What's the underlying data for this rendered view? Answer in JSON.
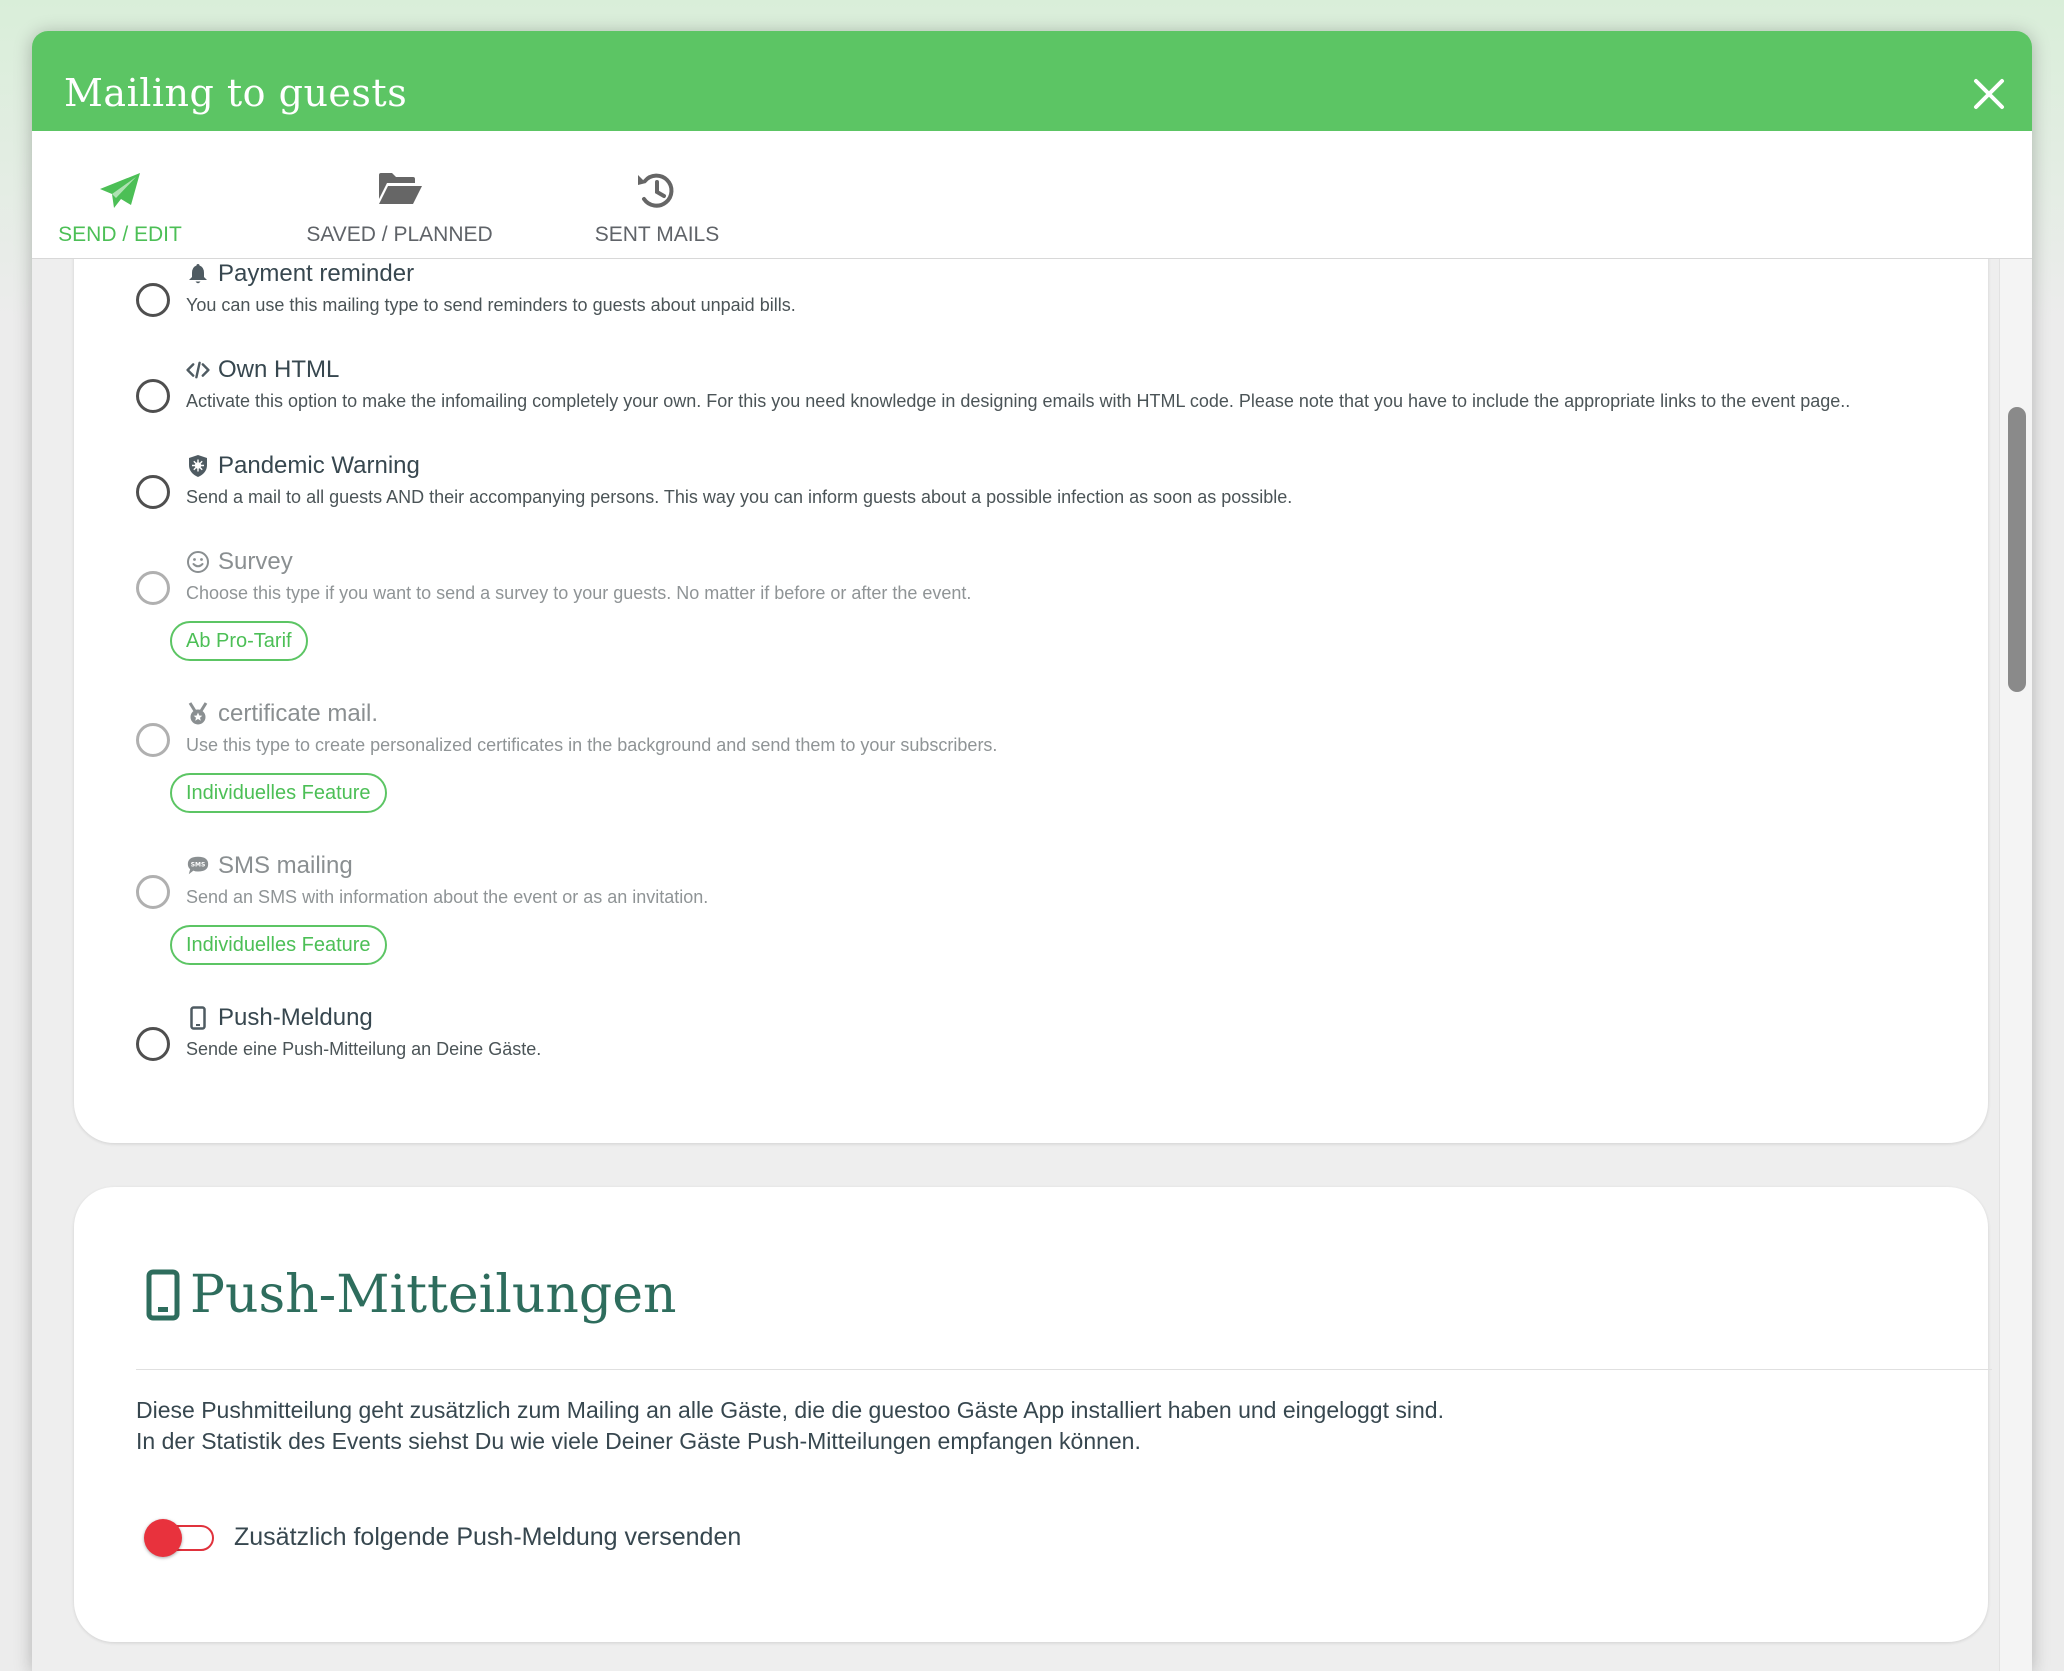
{
  "modal": {
    "title": "Mailing to guests"
  },
  "tabs": [
    {
      "label": "SEND / EDIT",
      "icon": "paper-plane-icon",
      "active": true
    },
    {
      "label": "SAVED / PLANNED",
      "icon": "folder-open-icon",
      "active": false
    },
    {
      "label": "SENT MAILS",
      "icon": "history-icon",
      "active": false
    }
  ],
  "mailing_types": [
    {
      "title": "Payment reminder",
      "icon": "bell-icon",
      "description": "You can use this mailing type to send reminders to guests about unpaid bills.",
      "selected": false,
      "disabled": false
    },
    {
      "title": "Own HTML",
      "icon": "code-icon",
      "description": "Activate this option to make the infomailing completely your own. For this you need knowledge in designing emails with HTML code. Please note that you have to include the appropriate links to the event page..",
      "selected": false,
      "disabled": false
    },
    {
      "title": "Pandemic Warning",
      "icon": "virus-shield-icon",
      "description": "Send a mail to all guests AND their accompanying persons. This way you can inform guests about a possible infection as soon as possible.",
      "selected": false,
      "disabled": false
    },
    {
      "title": "Survey",
      "icon": "smiley-icon",
      "description": "Choose this type if you want to send a survey to your guests. No matter if before or after the event.",
      "selected": false,
      "disabled": true,
      "badge": "Ab Pro-Tarif"
    },
    {
      "title": "certificate mail.",
      "icon": "medal-icon",
      "description": "Use this type to create personalized certificates in the background and send them to your subscribers.",
      "selected": false,
      "disabled": true,
      "badge": "Individuelles Feature"
    },
    {
      "title": "SMS mailing",
      "icon": "sms-icon",
      "description": "Send an SMS with information about the event or as an invitation.",
      "selected": false,
      "disabled": true,
      "badge": "Individuelles Feature"
    },
    {
      "title": "Push-Meldung",
      "icon": "mobile-phone-icon",
      "description": "Sende eine Push-Mitteilung an Deine Gäste.",
      "selected": false,
      "disabled": false
    }
  ],
  "push_section": {
    "title": "Push-Mitteilungen",
    "icon": "mobile-phone-icon",
    "text_line1": "Diese Pushmitteilung geht zusätzlich zum Mailing an alle Gäste, die die guestoo Gäste App installiert haben und eingeloggt sind.",
    "text_line2": "In der Statistik des Events siehst Du wie viele Deiner Gäste Push-Mitteilungen empfangen können.",
    "toggle_label": "Zusätzlich folgende Push-Meldung versenden",
    "toggle_on": false
  },
  "colors": {
    "header_green": "#5cc564",
    "accent_green": "#4cbf56",
    "title_teal": "#2e6d5d",
    "toggle_red": "#e8323d"
  }
}
